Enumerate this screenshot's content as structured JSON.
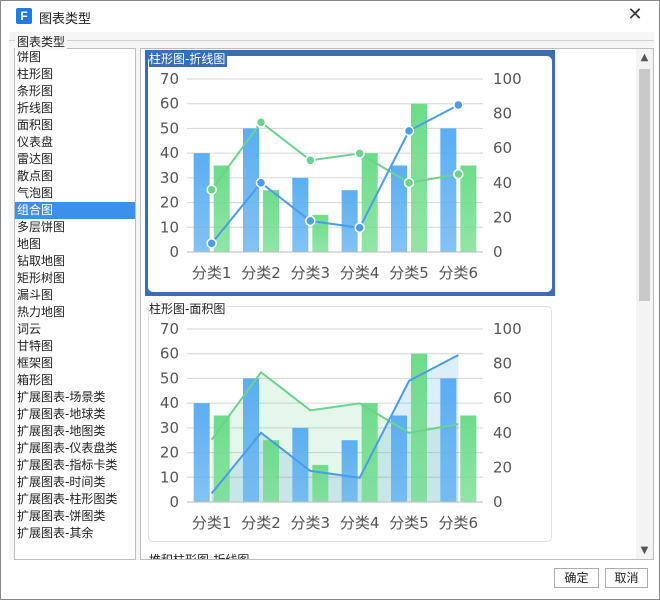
{
  "window": {
    "title": "图表类型",
    "logo_text": "F"
  },
  "section": {
    "label": "图表类型"
  },
  "chart_types": [
    "饼图",
    "柱形图",
    "条形图",
    "折线图",
    "面积图",
    "仪表盘",
    "雷达图",
    "散点图",
    "气泡图",
    "组合图",
    "多层饼图",
    "地图",
    "钻取地图",
    "矩形树图",
    "漏斗图",
    "热力地图",
    "词云",
    "甘特图",
    "框架图",
    "箱形图",
    "扩展图表-场景类",
    "扩展图表-地球类",
    "扩展图表-地图类",
    "扩展图表-仪表盘类",
    "扩展图表-指标卡类",
    "扩展图表-时间类",
    "扩展图表-柱形图类",
    "扩展图表-饼图类",
    "扩展图表-其余"
  ],
  "selected_type": "组合图",
  "previews": [
    {
      "title": "柱形图-折线图",
      "selected": true
    },
    {
      "title": "柱形图-面积图",
      "selected": false
    },
    {
      "title": "堆积柱形图-折线图",
      "selected": false
    }
  ],
  "buttons": {
    "ok": "确定",
    "cancel": "取消"
  },
  "colors": {
    "bar1": "#5aaef2",
    "bar2": "#6ddc8a",
    "line_blue": "#4a9de6",
    "line_green": "#6cd38c",
    "selected_border": "#3b6db3",
    "list_selection": "#3d8fe8"
  },
  "chart_data": [
    {
      "type": "bar+line",
      "title": "柱形图-折线图",
      "categories": [
        "分类1",
        "分类2",
        "分类3",
        "分类4",
        "分类5",
        "分类6"
      ],
      "series": [
        {
          "type": "bar",
          "axis": "left",
          "values": [
            40,
            50,
            30,
            25,
            35,
            50
          ]
        },
        {
          "type": "bar",
          "axis": "left",
          "values": [
            35,
            25,
            15,
            40,
            60,
            35
          ]
        },
        {
          "type": "line",
          "axis": "right",
          "values": [
            36,
            75,
            53,
            57,
            40,
            45
          ]
        },
        {
          "type": "line",
          "axis": "right",
          "values": [
            5,
            40,
            18,
            14,
            70,
            85
          ]
        }
      ],
      "left_ticks": [
        0,
        10,
        20,
        30,
        40,
        50,
        60,
        70
      ],
      "right_ticks": [
        0,
        20,
        40,
        60,
        80,
        100
      ],
      "ylim_left": [
        0,
        70
      ],
      "ylim_right": [
        0,
        100
      ]
    },
    {
      "type": "bar+area",
      "title": "柱形图-面积图",
      "categories": [
        "分类1",
        "分类2",
        "分类3",
        "分类4",
        "分类5",
        "分类6"
      ],
      "series": [
        {
          "type": "bar",
          "axis": "left",
          "values": [
            40,
            50,
            30,
            25,
            35,
            50
          ]
        },
        {
          "type": "bar",
          "axis": "left",
          "values": [
            35,
            25,
            15,
            40,
            60,
            35
          ]
        },
        {
          "type": "area",
          "axis": "right",
          "values": [
            36,
            75,
            53,
            57,
            40,
            45
          ]
        },
        {
          "type": "area",
          "axis": "right",
          "values": [
            5,
            40,
            18,
            14,
            70,
            85
          ]
        }
      ],
      "left_ticks": [
        0,
        10,
        20,
        30,
        40,
        50,
        60,
        70
      ],
      "right_ticks": [
        0,
        20,
        40,
        60,
        80,
        100
      ],
      "ylim_left": [
        0,
        70
      ],
      "ylim_right": [
        0,
        100
      ]
    }
  ]
}
